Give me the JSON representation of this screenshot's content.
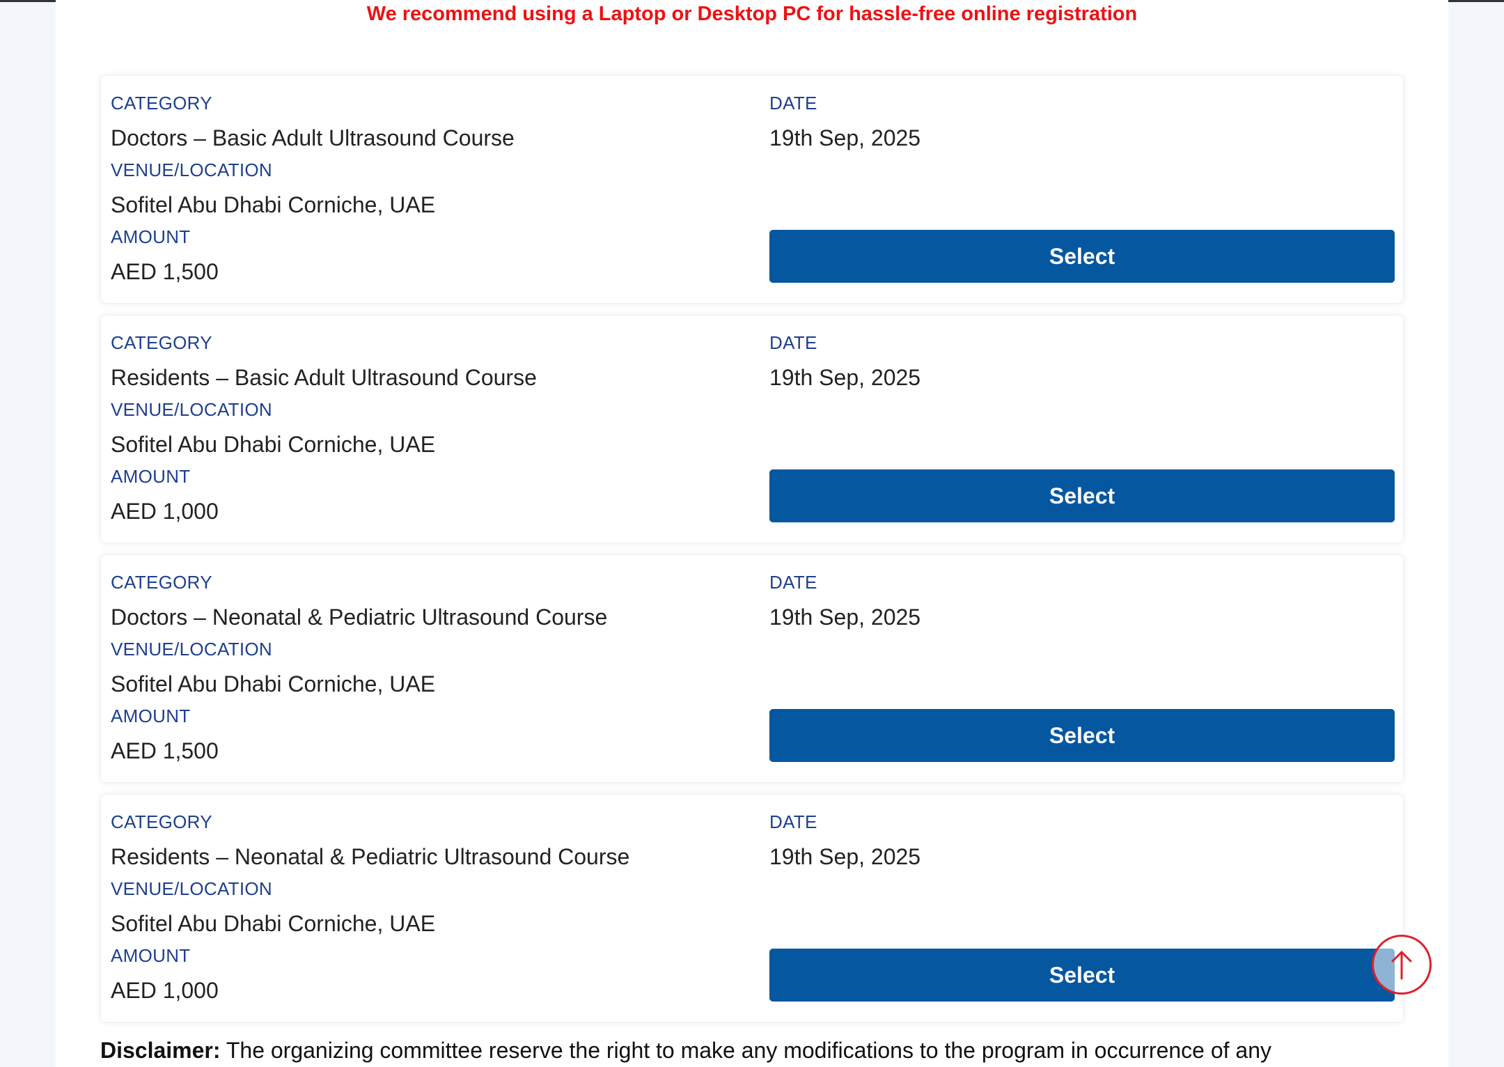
{
  "banner": {
    "recommendation": "We recommend using a Laptop or Desktop PC for hassle-free online registration"
  },
  "labels": {
    "category": "CATEGORY",
    "date": "DATE",
    "venue": "VENUE/LOCATION",
    "amount": "AMOUNT",
    "select": "Select"
  },
  "registrations": [
    {
      "category": "Doctors – Basic Adult Ultrasound Course",
      "date": "19th Sep, 2025",
      "venue": "Sofitel Abu Dhabi Corniche, UAE",
      "amount": "AED 1,500"
    },
    {
      "category": "Residents – Basic Adult Ultrasound Course",
      "date": "19th Sep, 2025",
      "venue": "Sofitel Abu Dhabi Corniche, UAE",
      "amount": "AED 1,000"
    },
    {
      "category": "Doctors – Neonatal & Pediatric Ultrasound Course",
      "date": "19th Sep, 2025",
      "venue": "Sofitel Abu Dhabi Corniche, UAE",
      "amount": "AED 1,500"
    },
    {
      "category": "Residents – Neonatal & Pediatric Ultrasound Course",
      "date": "19th Sep, 2025",
      "venue": "Sofitel Abu Dhabi Corniche, UAE",
      "amount": "AED 1,000"
    }
  ],
  "disclaimer": {
    "title": "Disclaimer:",
    "text": " The organizing committee reserve the right to make any modifications to the program in occurrence of any"
  },
  "icons": {
    "scroll_top": "arrow-up-icon"
  },
  "colors": {
    "accent": "#0557a0",
    "label": "#1e3f8f",
    "warning": "#ee1111",
    "scroll_ring": "#e0202a"
  }
}
